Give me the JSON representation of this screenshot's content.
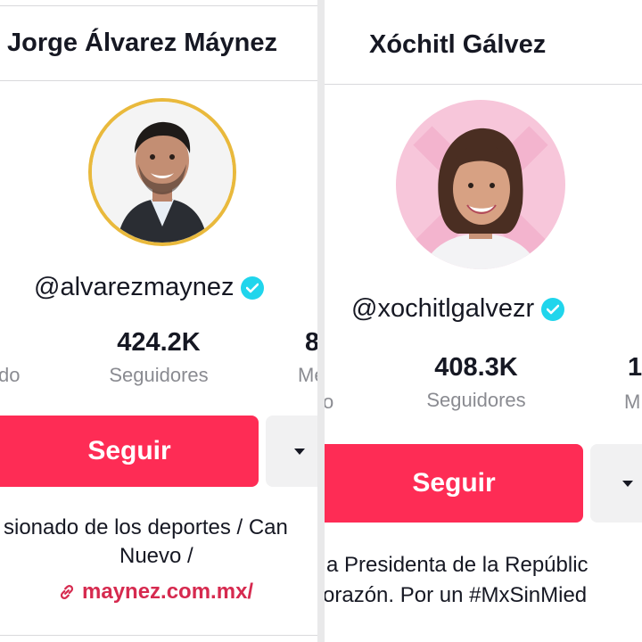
{
  "left": {
    "name": "Jorge Álvarez Máynez",
    "handle": "@alvarezmaynez",
    "left_stat_label_fragment": "do",
    "center_stat": {
      "value": "424.2K",
      "label": "Seguidores"
    },
    "right_stat": {
      "value_fragment": "8",
      "label_fragment": "Me"
    },
    "follow_label": "Seguir",
    "bio_line1": "sionado de los deportes / Can",
    "bio_line2": "Nuevo /",
    "link": "maynez.com.mx/",
    "avatar_ring_color": "#e9b93c"
  },
  "right": {
    "name": "Xóchitl Gálvez",
    "handle": "@xochitlgalvezr",
    "left_stat_label_fragment": "o",
    "center_stat": {
      "value": "408.3K",
      "label": "Seguidores"
    },
    "right_stat": {
      "value_fragment": "1",
      "label_fragment": "M"
    },
    "follow_label": "Seguir",
    "bio_line1": "a Presidenta de la Repúblic",
    "bio_line2": "orazón. Por un #MxSinMied",
    "avatar_bg_color": "#f7c6da"
  },
  "colors": {
    "follow": "#fe2c55",
    "verified": "#20d5ec",
    "link": "#d62a4f"
  },
  "icons": {
    "verified": "verified-check-icon",
    "dropdown": "caret-down-icon",
    "link": "link-chain-icon"
  }
}
